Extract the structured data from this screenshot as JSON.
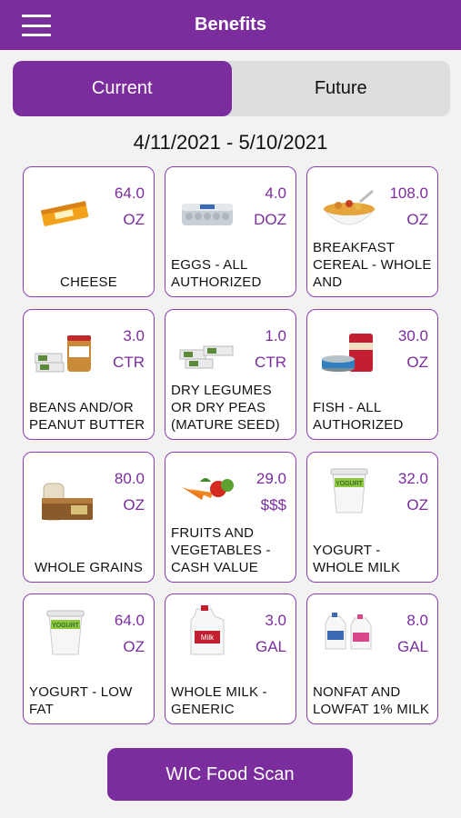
{
  "header": {
    "title": "Benefits",
    "menu_icon": "hamburger-menu-icon"
  },
  "tabs": [
    {
      "label": "Current",
      "active": true
    },
    {
      "label": "Future",
      "active": false
    }
  ],
  "date_range": "4/11/2021 - 5/10/2021",
  "colors": {
    "brand": "#7b2d9e",
    "background": "#f2f2f2"
  },
  "benefits": [
    {
      "amount": "64.0",
      "unit": "OZ",
      "name": "CHEESE",
      "icon": "cheese-icon"
    },
    {
      "amount": "4.0",
      "unit": "DOZ",
      "name": "EGGS - ALL AUTHORIZED",
      "icon": "eggs-icon"
    },
    {
      "amount": "108.0",
      "unit": "OZ",
      "name": "BREAKFAST CEREAL - WHOLE AND",
      "icon": "cereal-icon"
    },
    {
      "amount": "3.0",
      "unit": "CTR",
      "name": "BEANS AND/OR PEANUT BUTTER",
      "icon": "beans-peanut-butter-icon"
    },
    {
      "amount": "1.0",
      "unit": "CTR",
      "name": "DRY LEGUMES OR DRY PEAS (MATURE SEED)",
      "icon": "dry-legumes-icon"
    },
    {
      "amount": "30.0",
      "unit": "OZ",
      "name": "FISH - ALL AUTHORIZED",
      "icon": "canned-fish-icon"
    },
    {
      "amount": "80.0",
      "unit": "OZ",
      "name": "WHOLE GRAINS",
      "icon": "bread-icon"
    },
    {
      "amount": "29.0",
      "unit": "$$$",
      "name": "FRUITS AND VEGETABLES - CASH VALUE",
      "icon": "vegetables-icon"
    },
    {
      "amount": "32.0",
      "unit": "OZ",
      "name": "YOGURT - WHOLE MILK",
      "icon": "yogurt-icon"
    },
    {
      "amount": "64.0",
      "unit": "OZ",
      "name": "YOGURT - LOW FAT",
      "icon": "yogurt-lowfat-icon"
    },
    {
      "amount": "3.0",
      "unit": "GAL",
      "name": "WHOLE MILK - GENERIC",
      "icon": "milk-gallon-icon"
    },
    {
      "amount": "8.0",
      "unit": "GAL",
      "name": "NONFAT AND LOWFAT 1% MILK",
      "icon": "nonfat-milk-icon"
    }
  ],
  "scan_button": {
    "label": "WIC Food Scan"
  }
}
